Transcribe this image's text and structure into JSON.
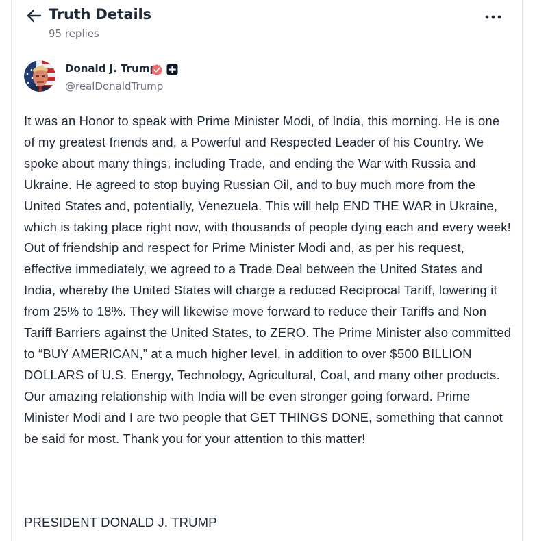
{
  "header": {
    "title": "Truth Details",
    "reply_count": "95 replies"
  },
  "author": {
    "name": "Donald J. Trump",
    "handle": "@realDonaldTrump",
    "verified_color": "#ef6b6b"
  },
  "post": {
    "body": "It was an Honor to speak with Prime Minister Modi, of India, this morning. He is one of my greatest friends and, a Powerful and Respected Leader of his Country. We spoke about many things, including Trade, and ending the War with Russia and Ukraine. He agreed to stop buying Russian Oil, and to buy much more from the United States and, potentially, Venezuela. This will help END THE WAR in Ukraine, which is taking place right now, with thousands of people dying each and every week! Out of friendship and respect for Prime Minister Modi and, as per his request, effective immediately, we agreed to a Trade Deal between the United States and India, whereby the United States will charge a reduced Reciprocal Tariff, lowering it from 25% to 18%. They will likewise move forward to reduce their Tariffs and Non Tariff Barriers against the United States, to ZERO. The Prime Minister also committed to “BUY AMERICAN,” at a much higher level, in addition to over $500 BILLION DOLLARS of U.S. Energy, Technology, Agricultural, Coal, and many other products. Our amazing relationship with India will be even stronger going forward. Prime Minister Modi and I are two people that GET THINGS DONE, something that cannot be said for most. Thank you for your attention to this matter!",
    "signature": "PRESIDENT DONALD J. TRUMP"
  },
  "icons": {
    "back": "arrow-left-icon",
    "more": "more-horizontal-icon",
    "verified": "verified-badge-icon",
    "plus": "plus-badge-icon"
  }
}
